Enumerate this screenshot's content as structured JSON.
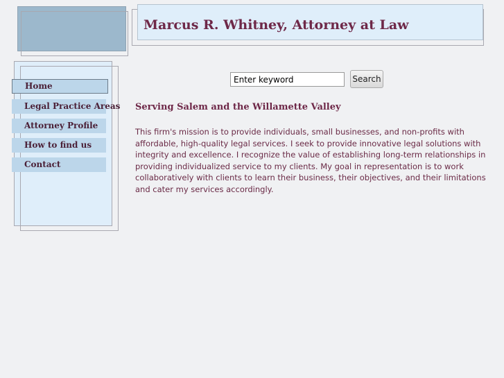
{
  "header": {
    "title": "Marcus R. Whitney, Attorney at Law"
  },
  "nav": {
    "items": [
      {
        "label": "Home",
        "active": true
      },
      {
        "label": "Legal Practice Areas",
        "active": false
      },
      {
        "label": "Attorney Profile",
        "active": false
      },
      {
        "label": "How to find us",
        "active": false
      },
      {
        "label": "Contact",
        "active": false
      }
    ]
  },
  "search": {
    "value": "Enter keyword",
    "button_label": "Search"
  },
  "main": {
    "heading": "Serving Salem and the Willamette Valley",
    "mission": "This firm's mission is to provide individuals, small businesses, and non-profits with affordable, high-quality legal services. I seek to provide innovative legal solutions with integrity and excellence.  I recognize the value of establishing long-term relationships in providing individualized service to my clients. My goal in representation is to work collaboratively with clients to learn their business, their objectives, and their limitations and cater my services accordingly."
  },
  "colors": {
    "accent_text": "#6e2848",
    "header_background": "#dfeefa",
    "nav_item_background": "#bcd6ea",
    "logo_block": "#9cb8cc",
    "page_background": "#f0f1f3"
  }
}
